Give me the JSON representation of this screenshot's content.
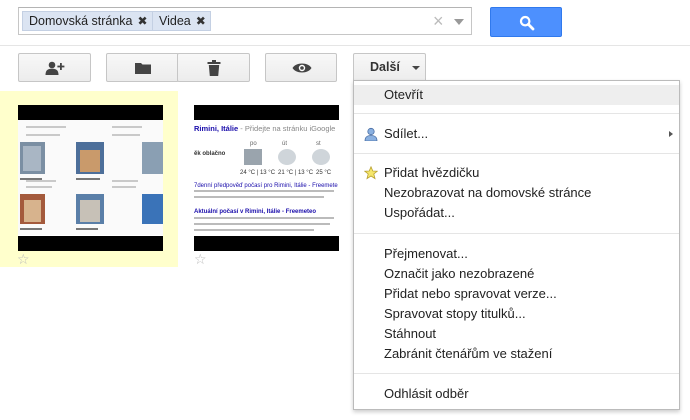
{
  "search": {
    "chips": [
      {
        "label": "Domovská stránka"
      },
      {
        "label": "Videa"
      }
    ],
    "clear": "×",
    "chip_remove": "✖"
  },
  "toolbar": {
    "more_label": "Další",
    "icons": [
      "add-person-icon",
      "folder-icon",
      "trash-icon",
      "eye-icon"
    ]
  },
  "files": [
    {
      "selected": true,
      "starred": false
    },
    {
      "selected": false,
      "starred": false,
      "thumb_text": {
        "heading": "Rimini, Itálie",
        "subtitle": "- Přidejte na stránku iGoogle",
        "weather_days": [
          "po",
          "út",
          "st"
        ],
        "cloudy": "ěk oblačno",
        "temp1": "24 °C | 13 °C",
        "temp2": "21 °C | 13 °C",
        "temp3": "25 °C",
        "line_a": "7denní předpověď počasí pro Rimini, Itálie - Freemete",
        "line_b": "Aktuální počasí v Rimini, Itálie - Freemeteo"
      }
    }
  ],
  "menu": {
    "items": [
      {
        "label": "Otevřít",
        "highlighted": true
      },
      {
        "label": "Sdílet...",
        "submenu": true,
        "icon": "share-person-icon"
      },
      {
        "label": "Přidat hvězdičku",
        "icon": "star-icon"
      },
      {
        "label": "Nezobrazovat na domovské stránce"
      },
      {
        "label": "Uspořádat..."
      },
      {
        "label": "Přejmenovat..."
      },
      {
        "label": "Označit jako nezobrazené"
      },
      {
        "label": "Přidat nebo spravovat verze..."
      },
      {
        "label": "Spravovat stopy titulků..."
      },
      {
        "label": "Stáhnout"
      },
      {
        "label": "Zabránit čtenářům ve stažení"
      },
      {
        "label": "Odhlásit odběr"
      }
    ]
  },
  "colors": {
    "accent": "#4d90fe",
    "chip": "#dbe4f2",
    "selected_tile": "#ffffcc",
    "star": "#f5c518"
  }
}
